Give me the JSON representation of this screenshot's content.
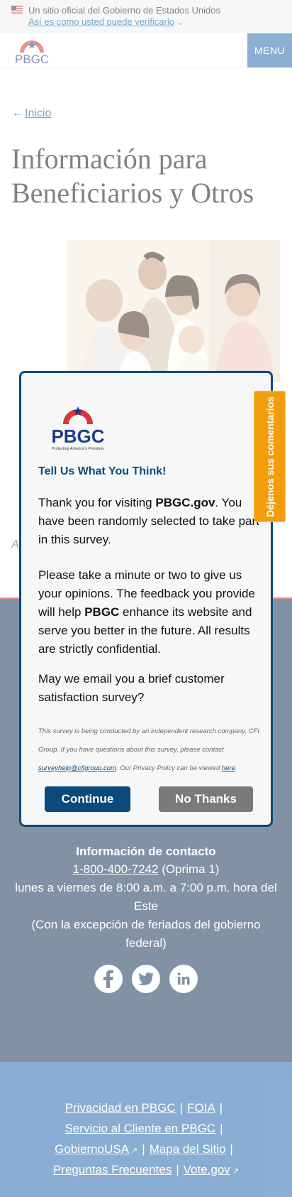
{
  "gov_banner": {
    "text": "Un sitio oficial del Gobierno de Estados Unidos",
    "link": "Así es como usted puede verificarlo"
  },
  "header": {
    "logo_text": "PBGC",
    "menu_label": "MENU"
  },
  "main": {
    "breadcrumb": "Inicio",
    "title": "Información para Beneficiarios y Otros",
    "partial_text": "A"
  },
  "footer": {
    "contact_heading": "Información de contacto",
    "phone": "1-800-400-7242",
    "phone_suffix": " (Oprima 1)",
    "hours_line1": "lunes a viernes de 8:00 a.m. a 7:00 p.m. hora del",
    "hours_line2": "Este",
    "holiday_line1": "(Con la excepción de feriados del gobierno",
    "holiday_line2": "federal)",
    "socials": [
      "facebook-icon",
      "twitter-icon",
      "linkedin-icon"
    ],
    "links": {
      "privacy": "Privacidad en PBGC",
      "foia": "FOIA",
      "customer_service": "Servicio al Cliente en PBGC",
      "usagov": "GobiernoUSA",
      "sitemap": "Mapa del Sitio",
      "faq": "Preguntas Frecuentes",
      "vote": "Vote.gov"
    }
  },
  "survey": {
    "logo_text": "PBGC",
    "logo_tagline": "Protecting America's Pensions",
    "heading": "Tell Us What You Think!",
    "p1_a": "Thank you for visiting ",
    "p1_b": "PBGC.gov",
    "p1_c": ". You have been randomly selected to take part in this survey.",
    "p2_a": "Please take a minute or two to give us your opinions. The feedback you provide will help ",
    "p2_b": "PBGC",
    "p2_c": " enhance its website and serve you better in the future. All results are strictly confidential.",
    "p3": "May we email you a brief customer satisfaction survey?",
    "fine_a": "This survey is being conducted by an independent research company, CFI Group. If you have questions about this survey, please contact ",
    "fine_email": "surveyhelp@cfigroup.com",
    "fine_b": ". Our Privacy Policy can be viewed ",
    "fine_here": "here",
    "fine_c": ".",
    "continue": "Continue",
    "no_thanks": "No Thanks"
  },
  "feedback_tab": "Déjenos sus comentarios",
  "colors": {
    "accent": "#005ea2",
    "modal_border": "#0b4a7a",
    "footer_dark": "#1b3a5c",
    "footer_links": "#2b6cb0",
    "feedback": "#f29e0c"
  }
}
